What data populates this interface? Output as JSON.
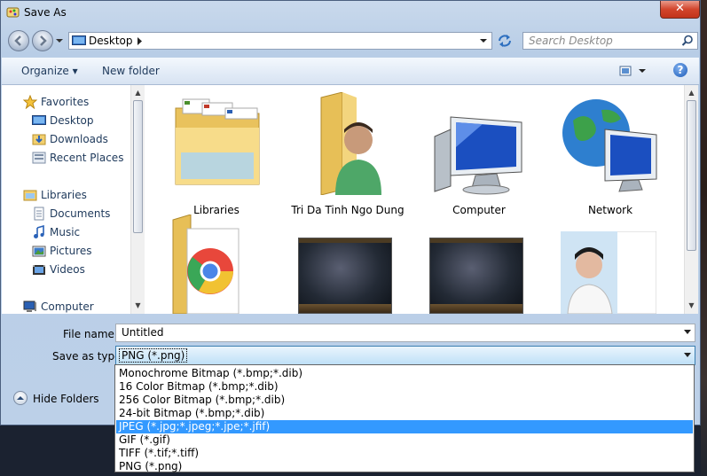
{
  "window": {
    "title": "Save As",
    "close_label": "✕"
  },
  "address": {
    "location": "Desktop",
    "search_placeholder": "Search Desktop"
  },
  "toolbar": {
    "organize": "Organize ▾",
    "new_folder": "New folder",
    "help": "?"
  },
  "nav": {
    "favorites": "Favorites",
    "desktop": "Desktop",
    "downloads": "Downloads",
    "recent": "Recent Places",
    "libraries": "Libraries",
    "documents": "Documents",
    "music": "Music",
    "pictures": "Pictures",
    "videos": "Videos",
    "computer": "Computer"
  },
  "files": {
    "libraries": "Libraries",
    "user": "Tri Da Tinh Ngo Dung",
    "computer": "Computer",
    "network": "Network"
  },
  "form": {
    "file_name_label": "File name:",
    "file_name_value": "Untitled",
    "type_label": "Save as type:",
    "type_value": "PNG (*.png)",
    "hide_folders": "Hide Folders"
  },
  "type_options": [
    "Monochrome Bitmap (*.bmp;*.dib)",
    "16 Color Bitmap (*.bmp;*.dib)",
    "256 Color Bitmap (*.bmp;*.dib)",
    "24-bit Bitmap (*.bmp;*.dib)",
    "JPEG (*.jpg;*.jpeg;*.jpe;*.jfif)",
    "GIF (*.gif)",
    "TIFF (*.tif;*.tiff)",
    "PNG (*.png)"
  ],
  "selected_option_index": 4
}
